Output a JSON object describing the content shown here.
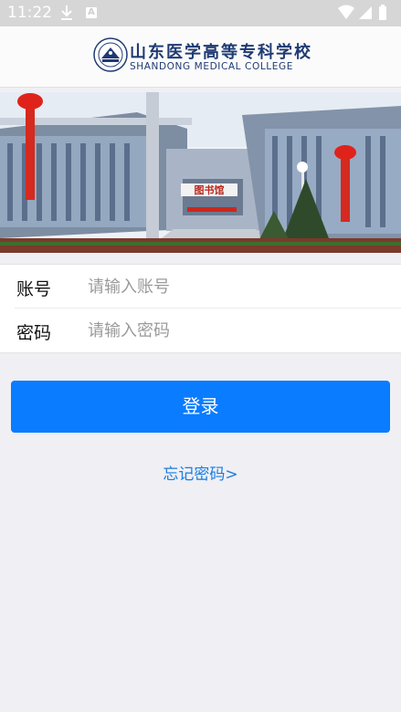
{
  "status_bar": {
    "time": "11:22",
    "notif_letter": "A"
  },
  "header": {
    "school_name_cn": "山东医学高等专科学校",
    "school_name_en": "SHANDONG MEDICAL COLLEGE"
  },
  "banner": {
    "gate_sign": "图书馆"
  },
  "form": {
    "account_label": "账号",
    "account_placeholder": "请输入账号",
    "password_label": "密码",
    "password_placeholder": "请输入密码"
  },
  "login_button": "登录",
  "forgot_password_link": "忘记密码>"
}
